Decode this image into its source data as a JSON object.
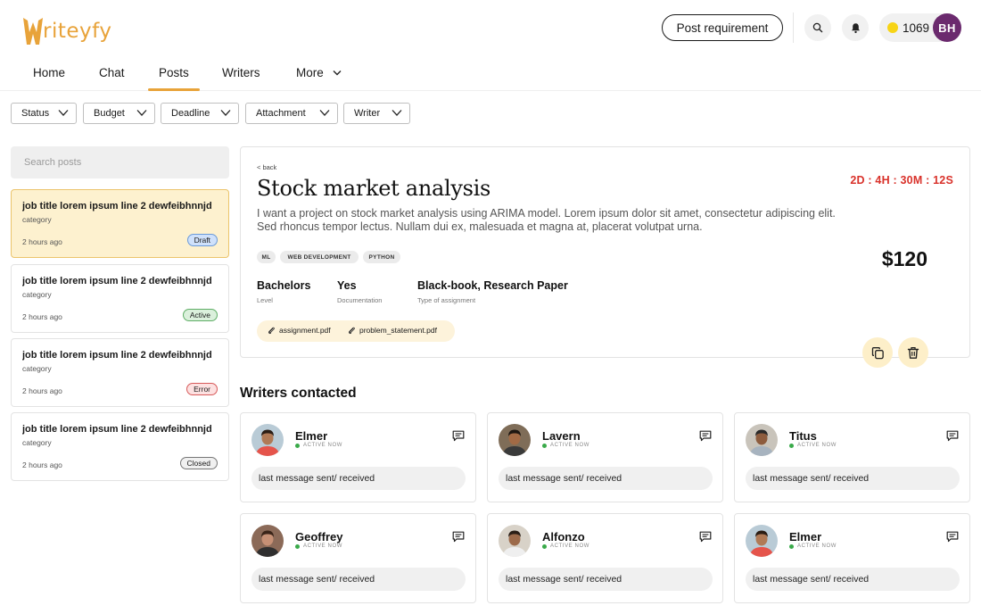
{
  "brand": {
    "logo_text": "riteyfy",
    "accent": "#e8a33a"
  },
  "header": {
    "post_requirement_label": "Post requirement",
    "coins": "1069",
    "avatar_initials": "BH"
  },
  "nav": {
    "items": [
      {
        "label": "Home"
      },
      {
        "label": "Chat"
      },
      {
        "label": "Posts",
        "active": true
      },
      {
        "label": "Writers"
      },
      {
        "label": "More"
      }
    ]
  },
  "filters": [
    "Status",
    "Budget",
    "Deadline",
    "Attachment",
    "Writer"
  ],
  "sidebar": {
    "search_placeholder": "Search posts",
    "posts": [
      {
        "title": "job title lorem ipsum line 2 dewfeibhnnjd",
        "category": "category",
        "time": "2 hours ago",
        "status": "Draft",
        "selected": true
      },
      {
        "title": "job title lorem ipsum line 2 dewfeibhnnjd",
        "category": "category",
        "time": "2 hours ago",
        "status": "Active"
      },
      {
        "title": "job title lorem ipsum line 2 dewfeibhnnjd",
        "category": "category",
        "time": "2 hours ago",
        "status": "Error"
      },
      {
        "title": "job title lorem ipsum line 2 dewfeibhnnjd",
        "category": "category",
        "time": "2 hours ago",
        "status": "Closed"
      }
    ]
  },
  "detail": {
    "back_label": "< back",
    "title": "Stock market analysis",
    "countdown": "2D : 4H : 30M : 12S",
    "description": "I want a project on stock market analysis using ARIMA model. Lorem ipsum dolor sit amet, consectetur adipiscing elit. Sed rhoncus tempor lectus. Nullam dui ex, malesuada et magna at, placerat volutpat urna.",
    "price": "$120",
    "tags": [
      "ML",
      "WEB DEVELOPMENT",
      "PYTHON"
    ],
    "meta": [
      {
        "value": "Bachelors",
        "label": "Level"
      },
      {
        "value": "Yes",
        "label": "Documentation"
      },
      {
        "value": "Black-book, Research Paper",
        "label": "Type of assignment"
      }
    ],
    "attachments": [
      "assignment.pdf",
      "problem_statement.pdf"
    ]
  },
  "writers": {
    "section_title": "Writers contacted",
    "status_label": "ACTIVE NOW",
    "items": [
      {
        "name": "Elmer",
        "message": "last message sent/ received"
      },
      {
        "name": "Lavern",
        "message": "last message sent/ received"
      },
      {
        "name": "Titus",
        "message": "last message sent/ received"
      },
      {
        "name": "Geoffrey",
        "message": "last message sent/ received"
      },
      {
        "name": "Alfonzo",
        "message": "last message sent/ received"
      },
      {
        "name": "Elmer",
        "message": "last message sent/ received"
      }
    ]
  }
}
